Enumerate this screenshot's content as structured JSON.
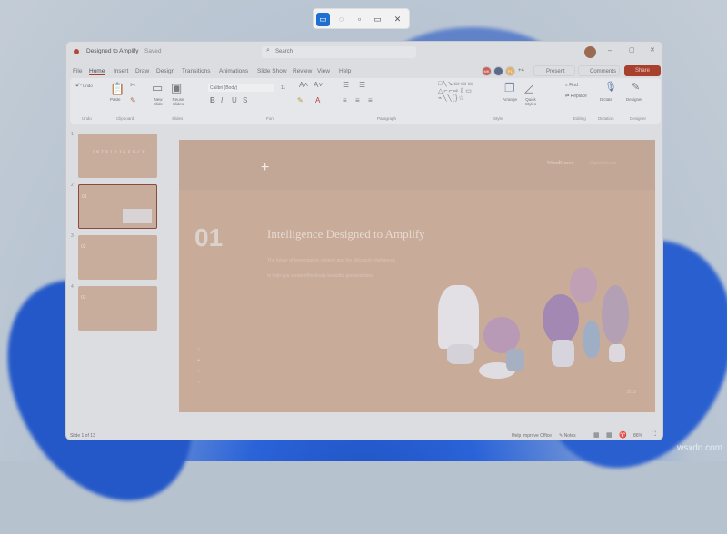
{
  "snip_toolbar": {
    "modes": [
      {
        "name": "rectangular-snip",
        "active": true
      },
      {
        "name": "freeform-snip"
      },
      {
        "name": "window-snip"
      },
      {
        "name": "fullscreen-snip"
      }
    ],
    "close": "✕"
  },
  "window": {
    "title": "Designed to Amplify",
    "status": "Saved",
    "search_placeholder": "Search"
  },
  "menu_tabs": [
    "File",
    "Home",
    "Insert",
    "Draw",
    "Design",
    "Transitions",
    "Animations",
    "Slide Show",
    "Review",
    "View",
    "Help"
  ],
  "active_tab": "Home",
  "collab": {
    "avatars": [
      "MK",
      "",
      "FL"
    ],
    "more": "+4",
    "present": "Present",
    "comments": "Comments",
    "share": "Share"
  },
  "ribbon": {
    "undo": "Undo",
    "paste": "Paste",
    "new_slide": "New Slide",
    "reuse_slides": "Reuse Slides",
    "font_name": "Calibri (Body)",
    "font_size": "11",
    "arrange": "Arrange",
    "quick_styles": "Quick Styles",
    "find": "Find",
    "replace": "Replace",
    "dictate": "Dictate",
    "designer": "Designer",
    "groups": [
      "Undo",
      "Clipboard",
      "Slides",
      "Font",
      "Paragraph",
      "Style",
      "Editing",
      "Dictation",
      "Designer"
    ]
  },
  "thumbnails": [
    {
      "num": "1",
      "text": "INTELLIGENCE"
    },
    {
      "num": "2",
      "text": "01",
      "selected": true
    },
    {
      "num": "3",
      "text": "02"
    },
    {
      "num": "4",
      "text": "03"
    }
  ],
  "slide": {
    "number": "01",
    "title": "Intelligence Designed to Amplify",
    "body_line1": "The future of presentation content and the Microsoft intelligence",
    "body_line2": "to help you create effortlessly beautiful presentations",
    "brand": "WoodGrove",
    "brand_sub": "Digital Studio",
    "page": "2/13"
  },
  "status_bar": {
    "slide_info": "Slide 1 of 13",
    "help": "Help Improve Office",
    "notes": "Notes",
    "zoom": "86%"
  },
  "watermark": "wsxdn.com",
  "colors": {
    "share": "#a8402e",
    "snip_active": "#1f6fd0",
    "slide": "#c9ab9a"
  }
}
